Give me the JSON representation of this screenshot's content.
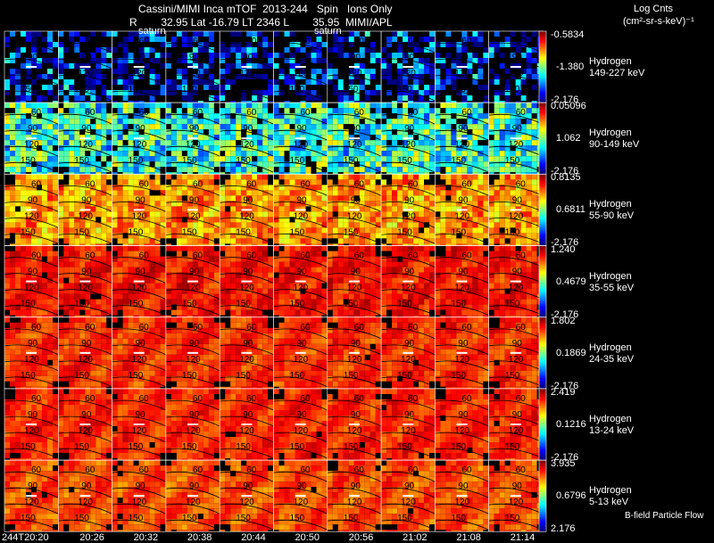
{
  "header": {
    "title_line1": "Cassini/MIMI Inca mTOF  2013-244   Spin   Ions Only",
    "title_line2": "R        32.95 Lat -16.79 LT 2346 L        35.95  MIMI/APL",
    "units_line1": "Log Cnts",
    "units_line2": "(cm²-sr-s-keV)⁻¹"
  },
  "footer_note": "B-field Particle Flow",
  "saturn_label": "saturn",
  "chart_data": {
    "type": "heatmap",
    "xlabel": "",
    "x_ticks": [
      "244T20:20",
      "20:26",
      "20:32",
      "20:38",
      "20:44",
      "20:50",
      "20:56",
      "21:02",
      "21:08",
      "21:14"
    ],
    "contour_labels": [
      "60",
      "90",
      "120",
      "150"
    ],
    "rows": [
      {
        "species": "Hydrogen",
        "energy": "149-227 keV",
        "cb_max": "-0.5834",
        "cb_mid": "-1.380",
        "cb_min": "-2.176",
        "level": 0.12,
        "noise": 0.6,
        "holes": 0.45
      },
      {
        "species": "Hydrogen",
        "energy": "90-149 keV",
        "cb_max": "0.05096",
        "cb_mid": "1.062",
        "cb_min": "-2.176",
        "level": 0.42,
        "noise": 0.4,
        "holes": 0.06
      },
      {
        "species": "Hydrogen",
        "energy": "55-90 keV",
        "cb_max": "0.8135",
        "cb_mid": "0.6811",
        "cb_min": "-2.176",
        "level": 0.72,
        "noise": 0.22,
        "holes": 0.02
      },
      {
        "species": "Hydrogen",
        "energy": "35-55 keV",
        "cb_max": "1.240",
        "cb_mid": "0.4679",
        "cb_min": "-2.176",
        "level": 0.86,
        "noise": 0.12,
        "holes": 0.01
      },
      {
        "species": "Hydrogen",
        "energy": "24-35 keV",
        "cb_max": "1.802",
        "cb_mid": "0.1869",
        "cb_min": "-2.176",
        "level": 0.83,
        "noise": 0.1,
        "holes": 0.01
      },
      {
        "species": "Hydrogen",
        "energy": "13-24 keV",
        "cb_max": "2.419",
        "cb_mid": "0.1216",
        "cb_min": "-2.176",
        "level": 0.84,
        "noise": 0.1,
        "holes": 0.01
      },
      {
        "species": "Hydrogen",
        "energy": "5-13 keV",
        "cb_max": "3.935",
        "cb_mid": "0.6796",
        "cb_min": "2.176",
        "level": 0.8,
        "noise": 0.1,
        "holes": 0.01
      }
    ]
  }
}
